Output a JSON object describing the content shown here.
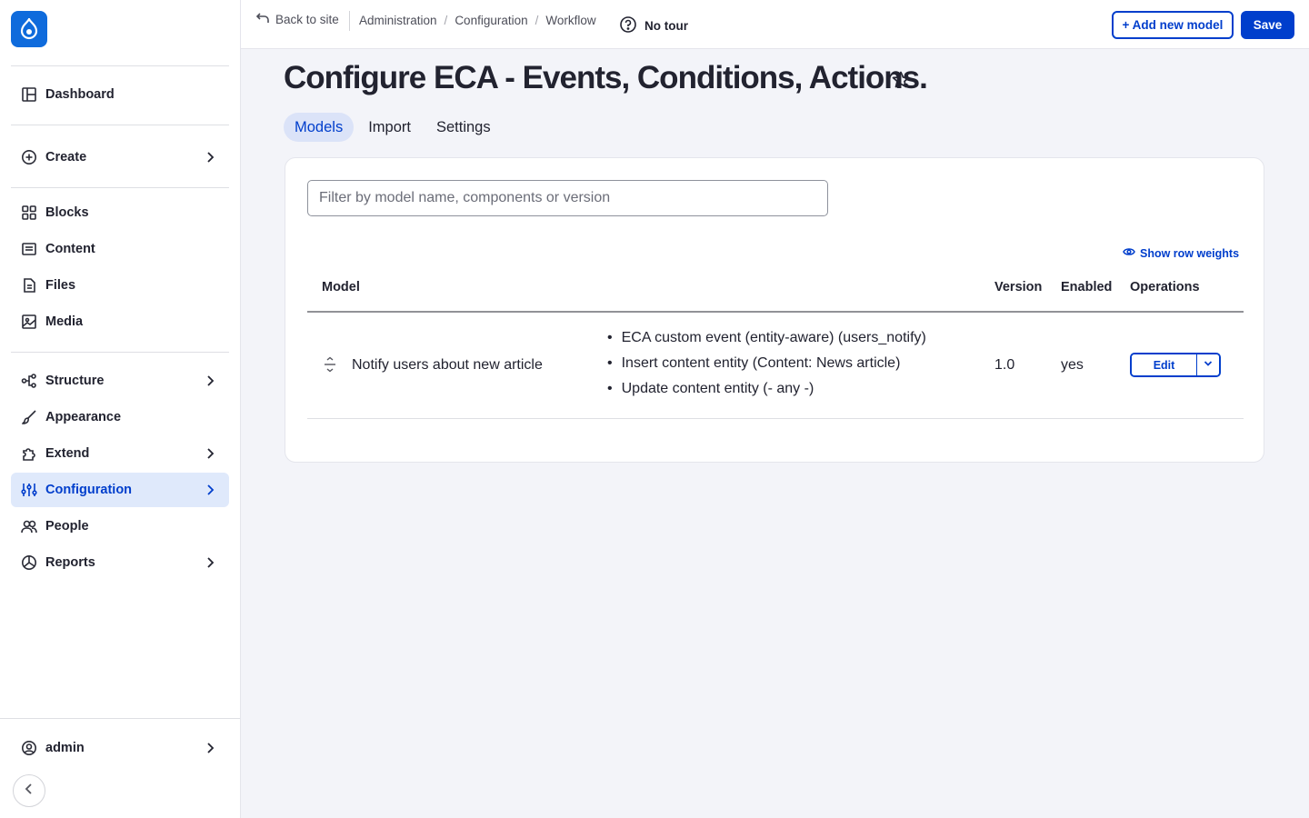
{
  "sidebar": {
    "logo_icon": "drupal-drop-icon",
    "items": [
      {
        "label": "Dashboard",
        "icon": "dashboard-icon"
      },
      {
        "label": "Create",
        "icon": "plus-circle-icon"
      },
      {
        "label": "Blocks",
        "icon": "blocks-icon"
      },
      {
        "label": "Content",
        "icon": "content-icon"
      },
      {
        "label": "Files",
        "icon": "files-icon"
      },
      {
        "label": "Media",
        "icon": "media-icon"
      },
      {
        "label": "Structure",
        "icon": "structure-icon"
      },
      {
        "label": "Appearance",
        "icon": "brush-icon"
      },
      {
        "label": "Extend",
        "icon": "puzzle-icon"
      },
      {
        "label": "Configuration",
        "icon": "sliders-icon",
        "active": true
      },
      {
        "label": "People",
        "icon": "people-icon"
      },
      {
        "label": "Reports",
        "icon": "reports-icon"
      }
    ],
    "user": {
      "label": "admin",
      "icon": "user-circle-icon"
    }
  },
  "topbar": {
    "back_label": "Back to site",
    "breadcrumb": [
      "Administration",
      "Configuration",
      "Workflow"
    ],
    "tour_label": "No tour",
    "add_model_label": "+ Add new model",
    "save_label": "Save"
  },
  "page": {
    "title": "Configure ECA - Events, Conditions, Actions.",
    "tabs": [
      {
        "label": "Models",
        "active": true
      },
      {
        "label": "Import"
      },
      {
        "label": "Settings"
      }
    ]
  },
  "models": {
    "filter_placeholder": "Filter by model name, components or version",
    "show_weights_label": "Show row weights",
    "columns": {
      "model": "Model",
      "version": "Version",
      "enabled": "Enabled",
      "operations": "Operations"
    },
    "rows": [
      {
        "model": "Notify users about new article",
        "components": [
          "ECA custom event (entity-aware) (users_notify)",
          "Insert content entity (Content: News article)",
          "Update content entity (- any -)"
        ],
        "version": "1.0",
        "enabled": "yes",
        "edit_label": "Edit"
      }
    ]
  },
  "colors": {
    "accent": "#003ecc",
    "logo": "#0f6bdc",
    "active_bg": "#dfe9fb"
  }
}
